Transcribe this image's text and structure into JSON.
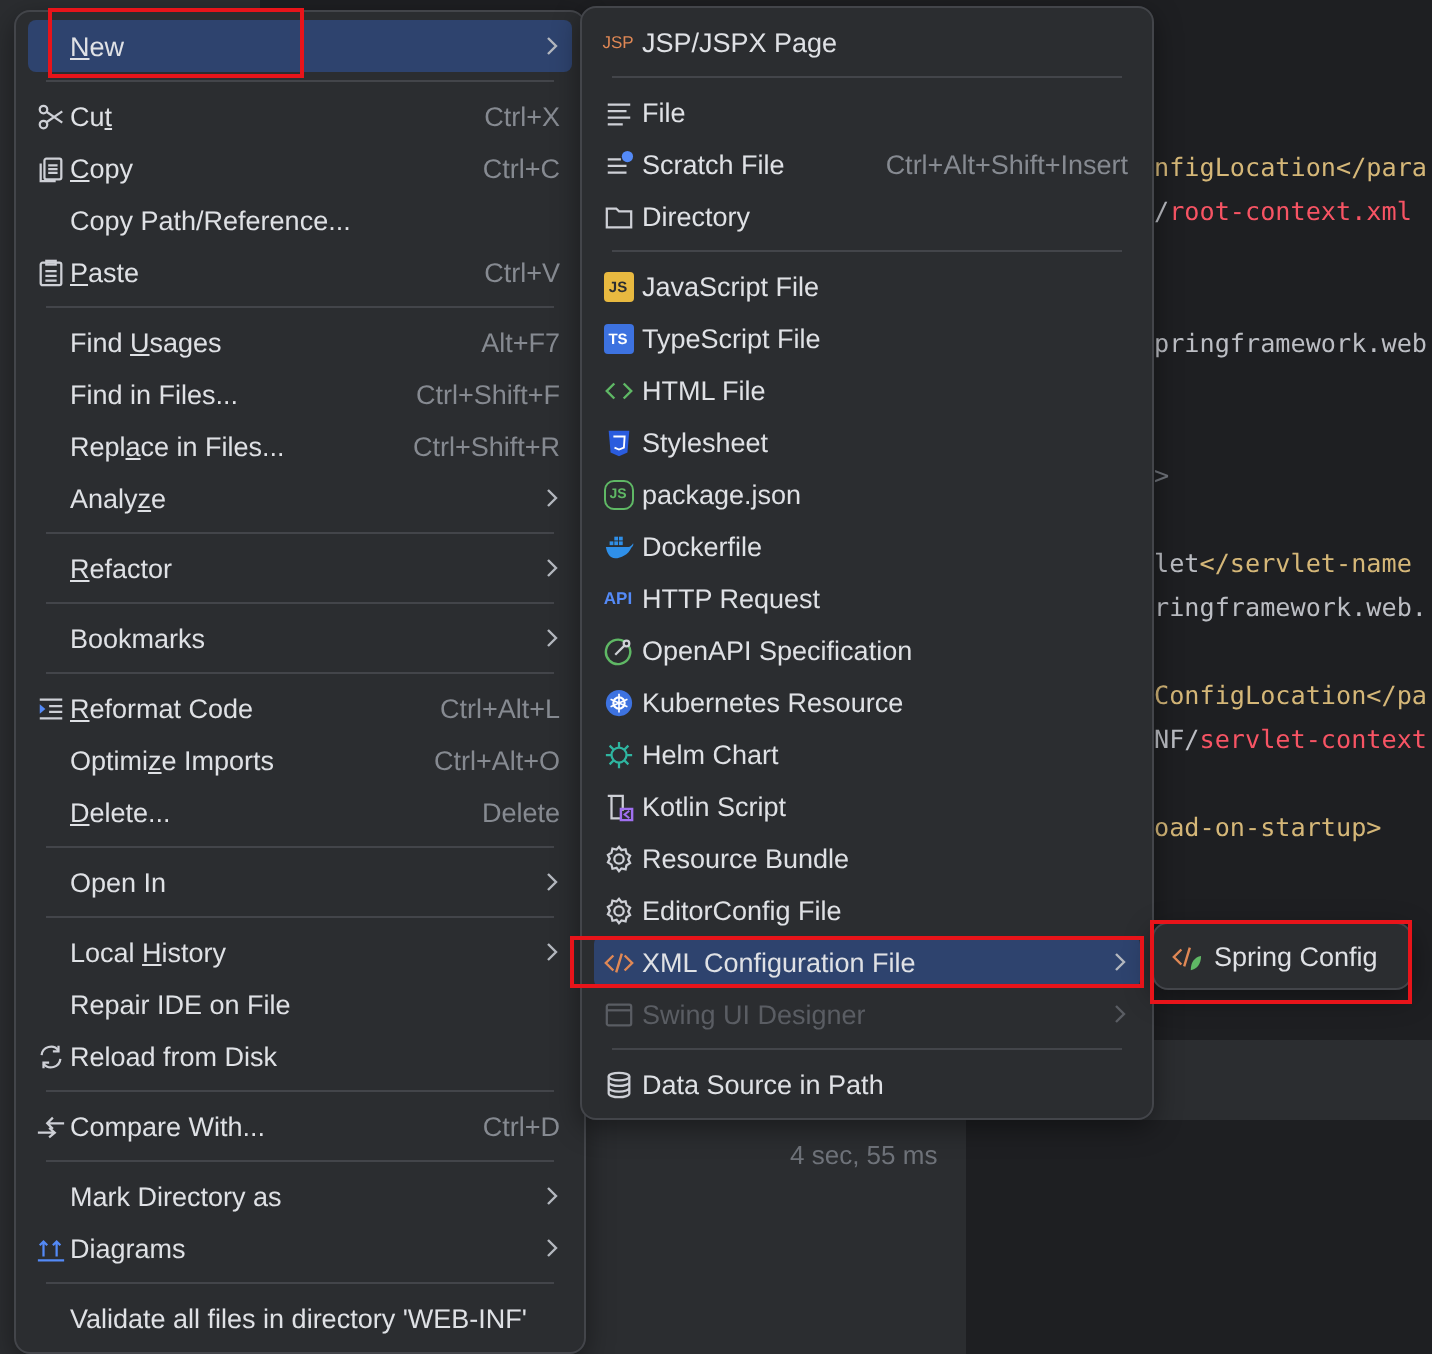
{
  "editor": {
    "lines": [
      {
        "kind": "blank"
      },
      {
        "kind": "blank"
      },
      {
        "kind": "blank"
      },
      {
        "kind": "blank"
      },
      {
        "kind": "code",
        "segments": [
          {
            "kind": "tag",
            "text": "nfigLocation</para"
          }
        ]
      },
      {
        "kind": "code",
        "segments": [
          {
            "kind": "text",
            "text": "/"
          },
          {
            "kind": "value",
            "text": "root-context.xml"
          }
        ]
      },
      {
        "kind": "blank"
      },
      {
        "kind": "blank"
      },
      {
        "kind": "code",
        "segments": [
          {
            "kind": "text",
            "text": "pringframework.web"
          }
        ]
      },
      {
        "kind": "blank"
      },
      {
        "kind": "blank"
      },
      {
        "kind": "code",
        "segments": [
          {
            "kind": "punct",
            "text": ">"
          }
        ]
      },
      {
        "kind": "blank"
      },
      {
        "kind": "code",
        "segments": [
          {
            "kind": "text",
            "text": "let"
          },
          {
            "kind": "tag",
            "text": "</servlet-name"
          }
        ]
      },
      {
        "kind": "code",
        "segments": [
          {
            "kind": "text",
            "text": "ringframework.web."
          }
        ]
      },
      {
        "kind": "blank"
      },
      {
        "kind": "code",
        "segments": [
          {
            "kind": "tag",
            "text": "ConfigLocation</pa"
          }
        ]
      },
      {
        "kind": "code",
        "segments": [
          {
            "kind": "text",
            "text": "NF/"
          },
          {
            "kind": "value",
            "text": "servlet-context"
          }
        ]
      },
      {
        "kind": "blank"
      },
      {
        "kind": "code",
        "segments": [
          {
            "kind": "tag",
            "text": "oad-on-startup>"
          }
        ]
      }
    ]
  },
  "status": {
    "duration": "4 sec, 55 ms"
  },
  "context_menu": {
    "sections": [
      [
        {
          "kind": "text",
          "label": {
            "key": "N",
            "after": "ew"
          },
          "submenu": true,
          "selected": true
        }
      ],
      [
        {
          "kind": "cut",
          "label": {
            "before": "Cu",
            "key": "t"
          },
          "shortcut": "Ctrl+X",
          "selected": false
        },
        {
          "kind": "copy",
          "label": {
            "key": "C",
            "after": "opy"
          },
          "shortcut": "Ctrl+C",
          "selected": false
        },
        {
          "kind": "text",
          "label": "Copy Path/Reference...",
          "selected": false
        },
        {
          "kind": "paste",
          "label": {
            "key": "P",
            "after": "aste"
          },
          "shortcut": "Ctrl+V",
          "selected": false
        }
      ],
      [
        {
          "kind": "text",
          "label": {
            "before": "Find ",
            "key": "U",
            "after": "sages"
          },
          "shortcut": "Alt+F7",
          "selected": false
        },
        {
          "kind": "text",
          "label": "Find in Files...",
          "shortcut": "Ctrl+Shift+F",
          "selected": false
        },
        {
          "kind": "text",
          "label": {
            "before": "Repl",
            "key": "a",
            "after": "ce in Files..."
          },
          "shortcut": "Ctrl+Shift+R",
          "selected": false
        },
        {
          "kind": "text",
          "label": {
            "before": "Analy",
            "key": "z",
            "after": "e"
          },
          "submenu": true,
          "selected": false
        }
      ],
      [
        {
          "kind": "text",
          "label": {
            "key": "R",
            "after": "efactor"
          },
          "submenu": true,
          "selected": false
        }
      ],
      [
        {
          "kind": "text",
          "label": "Bookmarks",
          "submenu": true,
          "selected": false
        }
      ],
      [
        {
          "kind": "reformat",
          "label": {
            "key": "R",
            "after": "eformat Code"
          },
          "shortcut": "Ctrl+Alt+L",
          "selected": false
        },
        {
          "kind": "text",
          "label": {
            "before": "Optimi",
            "key": "z",
            "after": "e Imports"
          },
          "shortcut": "Ctrl+Alt+O",
          "selected": false
        },
        {
          "kind": "text",
          "label": {
            "key": "D",
            "after": "elete..."
          },
          "shortcut": "Delete",
          "selected": false
        }
      ],
      [
        {
          "kind": "text",
          "label": "Open In",
          "submenu": true,
          "selected": false
        }
      ],
      [
        {
          "kind": "text",
          "label": {
            "before": "Local ",
            "key": "H",
            "after": "istory"
          },
          "submenu": true,
          "selected": false
        },
        {
          "kind": "text",
          "label": "Repair IDE on File",
          "selected": false
        },
        {
          "kind": "reload",
          "label": "Reload from Disk",
          "selected": false
        }
      ],
      [
        {
          "kind": "compare",
          "label": "Compare With...",
          "shortcut": "Ctrl+D",
          "selected": false
        }
      ],
      [
        {
          "kind": "text",
          "label": "Mark Directory as",
          "submenu": true,
          "selected": false
        },
        {
          "kind": "diagrams",
          "label": "Diagrams",
          "submenu": true,
          "selected": false
        }
      ],
      [
        {
          "kind": "text",
          "label": "Validate all files in directory 'WEB-INF'",
          "selected": false
        }
      ]
    ]
  },
  "new_menu": {
    "sections": [
      [
        {
          "kind": "jsp",
          "icon_text": "JSP",
          "label": "JSP/JSPX Page",
          "selected": false,
          "disabled": false
        }
      ],
      [
        {
          "kind": "file",
          "label": "File",
          "selected": false,
          "disabled": false
        },
        {
          "kind": "scratch",
          "label": "Scratch File",
          "shortcut": "Ctrl+Alt+Shift+Insert",
          "selected": false,
          "disabled": false
        },
        {
          "kind": "directory",
          "label": "Directory",
          "selected": false,
          "disabled": false
        }
      ],
      [
        {
          "kind": "javascript",
          "icon_text": "JS",
          "label": "JavaScript File",
          "selected": false,
          "disabled": false
        },
        {
          "kind": "typescript",
          "icon_text": "TS",
          "label": "TypeScript File",
          "selected": false,
          "disabled": false
        },
        {
          "kind": "html",
          "label": "HTML File",
          "selected": false,
          "disabled": false
        },
        {
          "kind": "css",
          "label": "Stylesheet",
          "selected": false,
          "disabled": false
        },
        {
          "kind": "npm",
          "icon_text": "JS",
          "label": "package.json",
          "selected": false,
          "disabled": false
        },
        {
          "kind": "docker",
          "label": "Dockerfile",
          "selected": false,
          "disabled": false
        },
        {
          "kind": "http",
          "icon_text": "API",
          "label": "HTTP Request",
          "selected": false,
          "disabled": false
        },
        {
          "kind": "openapi",
          "label": "OpenAPI Specification",
          "selected": false,
          "disabled": false
        },
        {
          "kind": "kubernetes",
          "label": "Kubernetes Resource",
          "selected": false,
          "disabled": false
        },
        {
          "kind": "helm",
          "label": "Helm Chart",
          "selected": false,
          "disabled": false
        },
        {
          "kind": "kotlin",
          "label": "Kotlin Script",
          "selected": false,
          "disabled": false
        },
        {
          "kind": "bundle",
          "label": "Resource Bundle",
          "selected": false,
          "disabled": false
        },
        {
          "kind": "bundle",
          "label": "EditorConfig File",
          "selected": false,
          "disabled": false
        },
        {
          "kind": "xml",
          "label": "XML Configuration File",
          "submenu": true,
          "selected": true,
          "disabled": false
        },
        {
          "kind": "swing",
          "label": "Swing UI Designer",
          "submenu": true,
          "selected": false,
          "disabled": true
        }
      ],
      [
        {
          "kind": "datasource",
          "label": "Data Source in Path",
          "selected": false,
          "disabled": false
        }
      ]
    ]
  },
  "xml_submenu": {
    "items": [
      {
        "kind": "spring",
        "label": "Spring Config",
        "selected": false
      }
    ]
  }
}
